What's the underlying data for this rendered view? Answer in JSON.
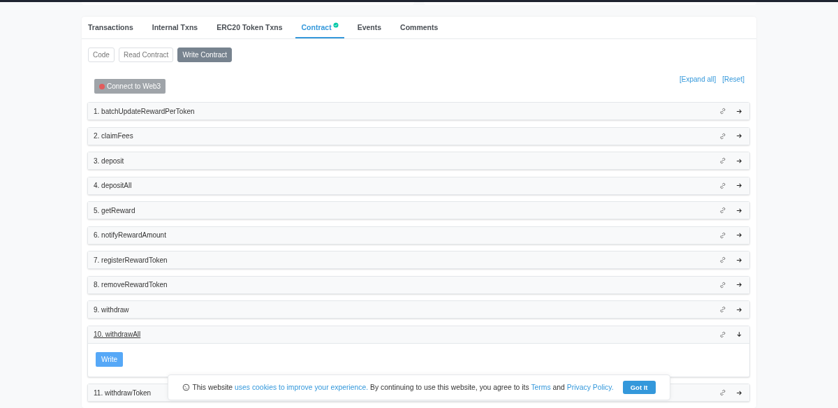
{
  "tabs": [
    {
      "label": "Transactions",
      "selected": false,
      "verified": false
    },
    {
      "label": "Internal Txns",
      "selected": false,
      "verified": false
    },
    {
      "label": "ERC20 Token Txns",
      "selected": false,
      "verified": false
    },
    {
      "label": "Contract",
      "selected": true,
      "verified": true
    },
    {
      "label": "Events",
      "selected": false,
      "verified": false
    },
    {
      "label": "Comments",
      "selected": false,
      "verified": false
    }
  ],
  "subtabs": [
    {
      "label": "Code",
      "selected": false
    },
    {
      "label": "Read Contract",
      "selected": false
    },
    {
      "label": "Write Contract",
      "selected": true
    }
  ],
  "connect_button": {
    "label": "Connect to Web3",
    "connected": false
  },
  "expand_all": "[Expand all]",
  "reset": "[Reset]",
  "functions": [
    {
      "name": "1. batchUpdateRewardPerToken",
      "expanded": false
    },
    {
      "name": "2. claimFees",
      "expanded": false
    },
    {
      "name": "3. deposit",
      "expanded": false
    },
    {
      "name": "4. depositAll",
      "expanded": false
    },
    {
      "name": "5. getReward",
      "expanded": false
    },
    {
      "name": "6. notifyRewardAmount",
      "expanded": false
    },
    {
      "name": "7. registerRewardToken",
      "expanded": false
    },
    {
      "name": "8. removeRewardToken",
      "expanded": false
    },
    {
      "name": "9. withdraw",
      "expanded": false
    },
    {
      "name": "10. withdrawAll",
      "expanded": true,
      "button": "Write"
    },
    {
      "name": "11. withdrawToken",
      "expanded": false
    }
  ],
  "cookie_banner": {
    "segments": [
      {
        "kind": "text",
        "text": "This website "
      },
      {
        "kind": "link",
        "text": "uses cookies to improve your experience."
      },
      {
        "kind": "text",
        "text": " By continuing to use this website, you agree to its "
      },
      {
        "kind": "link",
        "text": "Terms"
      },
      {
        "kind": "text",
        "text": " and "
      },
      {
        "kind": "link",
        "text": "Privacy Policy."
      }
    ],
    "button": "Got It"
  }
}
